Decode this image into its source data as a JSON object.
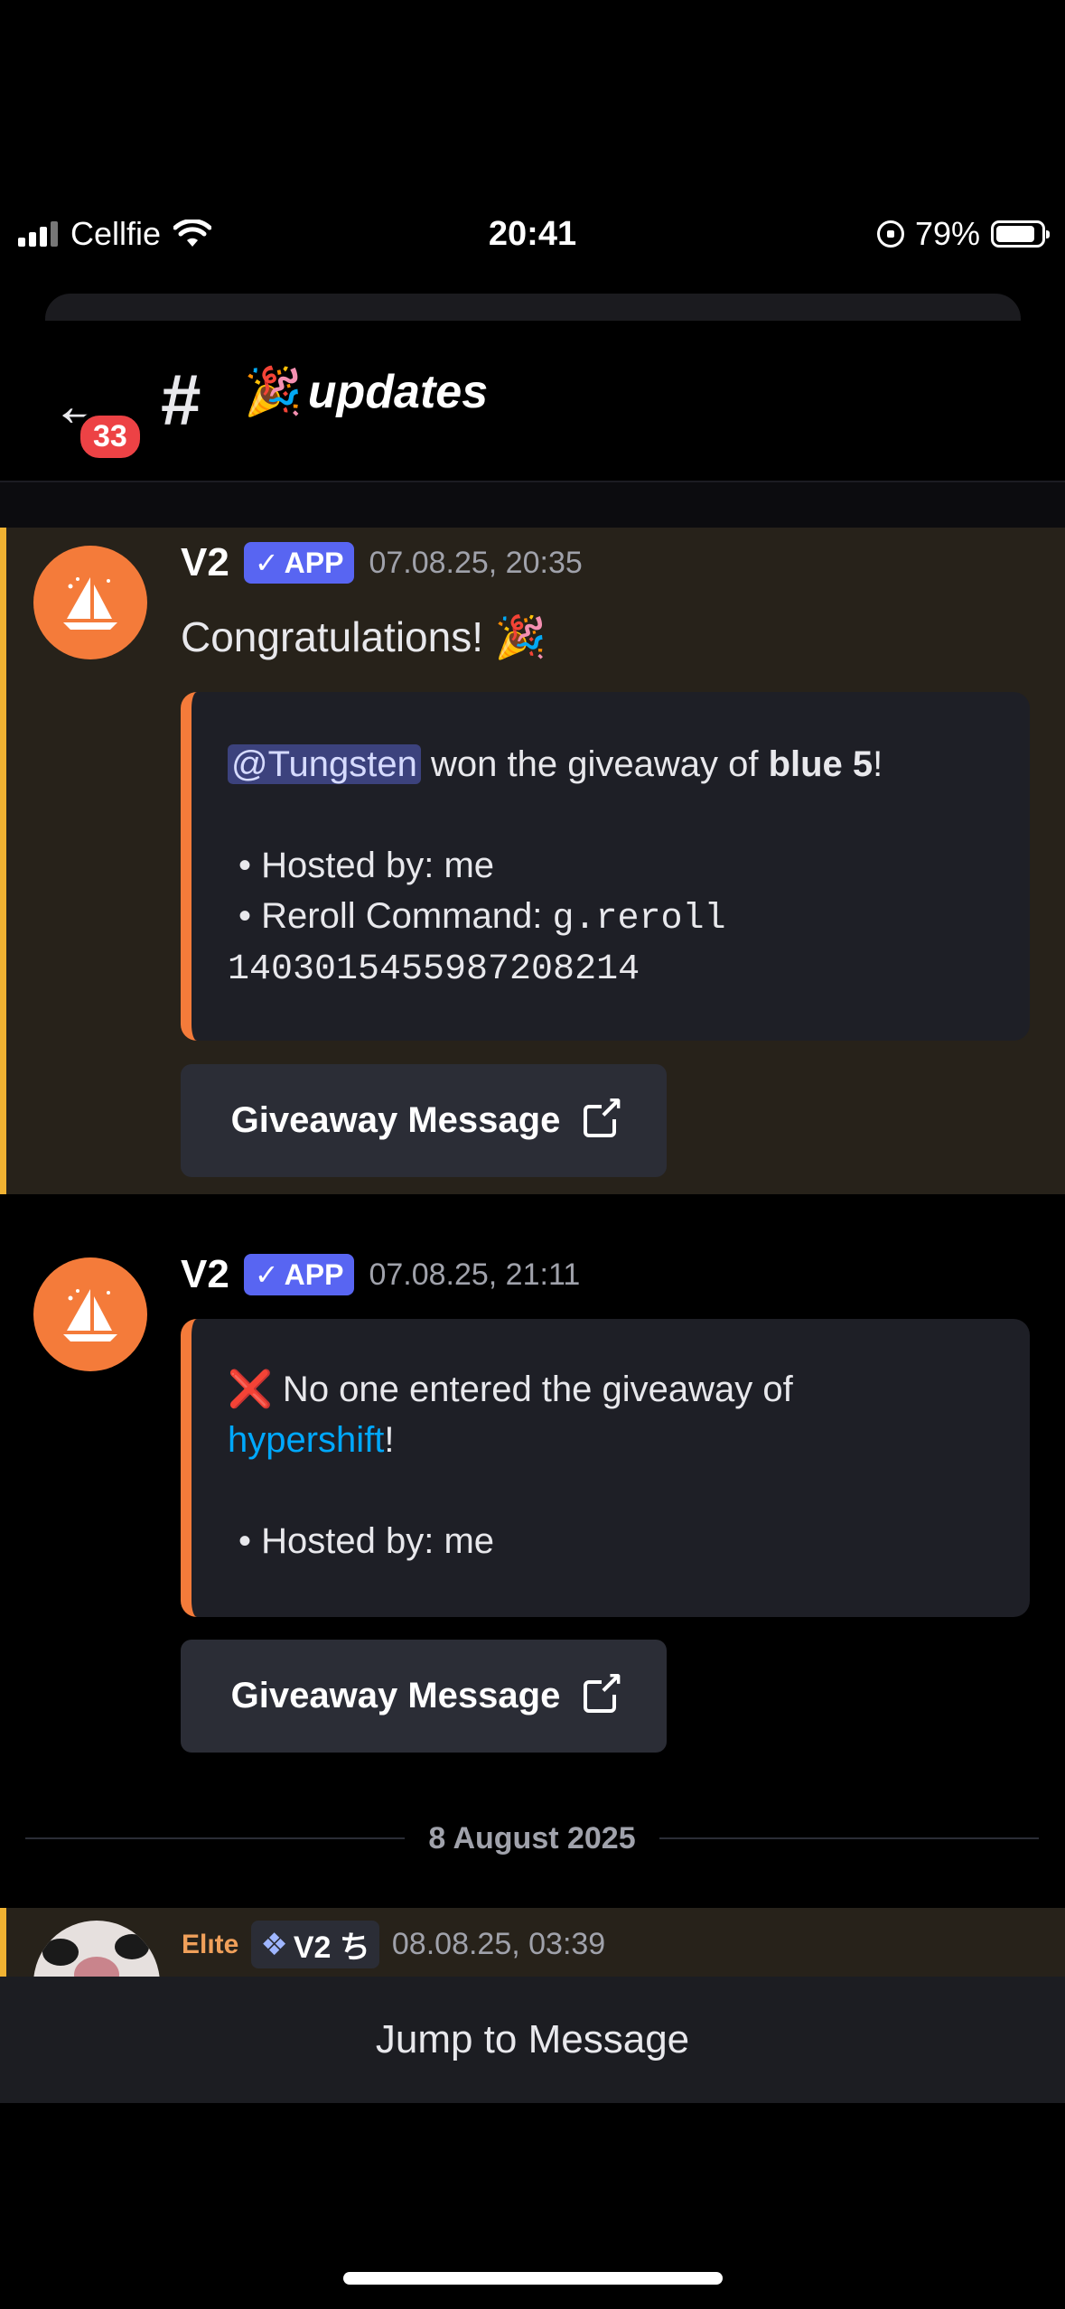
{
  "status_bar": {
    "carrier": "Cellfie",
    "time": "20:41",
    "battery": "79%"
  },
  "header": {
    "unread_count": "33",
    "hash": "#",
    "channel_emoji": "🎉",
    "channel_name": "updates"
  },
  "messages": [
    {
      "author": "V2",
      "tag": "APP",
      "timestamp": "07.08.25, 20:35",
      "text": "Congratulations! 🎉",
      "embed": {
        "mention": "@Tungsten",
        "line1_mid": " won the giveaway of ",
        "prize": "blue 5",
        "line1_end": "!",
        "hosted": "• Hosted by: me",
        "reroll_label": "• Reroll Command: ",
        "reroll_cmd": "g.reroll",
        "reroll_id": "1403015455987208214"
      },
      "button": "Giveaway Message"
    },
    {
      "author": "V2",
      "tag": "APP",
      "timestamp": "07.08.25, 21:11",
      "embed": {
        "emoji": "❌",
        "line1": " No one entered the giveaway of",
        "prize": "hypershift",
        "line2_end": "!",
        "hosted": "• Hosted by: me"
      },
      "button": "Giveaway Message"
    }
  ],
  "date_separator": "8 August 2025",
  "partial_message": {
    "author": "Elıte",
    "tag": "V2 ち",
    "timestamp": "08.08.25, 03:39"
  },
  "jump_button": "Jump to Message",
  "colors": {
    "accent": "#5865f2",
    "highlight_bar": "#f0b232",
    "embed_bar": "#f47b3a",
    "link": "#00a8fc"
  }
}
